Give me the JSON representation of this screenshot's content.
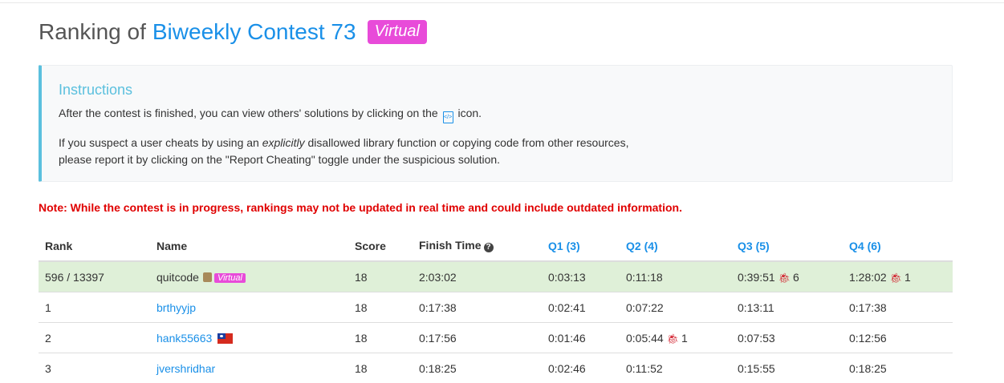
{
  "title": {
    "prefix": "Ranking of",
    "contest": "Biweekly Contest 73",
    "badge": "Virtual"
  },
  "instructions": {
    "heading": "Instructions",
    "p1_before": "After the contest is finished, you can view others' solutions by clicking on the",
    "p1_after": "icon.",
    "p2_a": "If you suspect a user cheats by using an",
    "p2_em": "explicitly",
    "p2_b": "disallowed library function or copying code from other resources,",
    "p2_c": "please report it by clicking on the \"Report Cheating\" toggle under the suspicious solution."
  },
  "note": "Note: While the contest is in progress, rankings may not be updated in real time and could include outdated information.",
  "columns": {
    "rank": "Rank",
    "name": "Name",
    "score": "Score",
    "finish": "Finish Time",
    "q1": "Q1 (3)",
    "q2": "Q2 (4)",
    "q3": "Q3 (5)",
    "q4": "Q4 (6)"
  },
  "me": {
    "rank": "596 / 13397",
    "name": "quitcode",
    "badge": "Virtual",
    "score": "18",
    "finish": "2:03:02",
    "q1": "0:03:13",
    "q2": "0:11:18",
    "q3": "0:39:51",
    "q3_bugs": "6",
    "q4": "1:28:02",
    "q4_bugs": "1"
  },
  "rows": [
    {
      "rank": "1",
      "name": "brthyyjp",
      "score": "18",
      "finish": "0:17:38",
      "q1": "0:02:41",
      "q2": "0:07:22",
      "q3": "0:13:11",
      "q4": "0:17:38"
    },
    {
      "rank": "2",
      "name": "hank55663",
      "score": "18",
      "finish": "0:17:56",
      "q1": "0:01:46",
      "q2": "0:05:44",
      "q2_bugs": "1",
      "q3": "0:07:53",
      "q4": "0:12:56"
    },
    {
      "rank": "3",
      "name": "jvershridhar",
      "score": "18",
      "finish": "0:18:25",
      "q1": "0:02:46",
      "q2": "0:11:52",
      "q3": "0:15:55",
      "q4": "0:18:25"
    }
  ],
  "colors": {
    "link": "#1a90e8",
    "virtual": "#e84bd9",
    "note": "#e00000",
    "highlight_row": "#dff0d8",
    "instructions_accent": "#5bc0de"
  }
}
